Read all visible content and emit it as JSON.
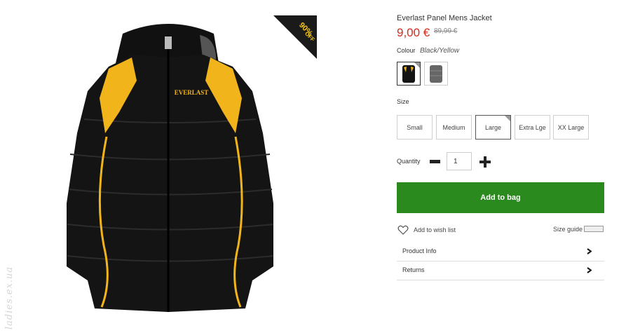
{
  "product": {
    "title": "Everlast Panel Mens Jacket",
    "price": "9,00 €",
    "old_price": "89,99 €",
    "badge_text": "UP TO 90% OFF",
    "brand_logo": "EVERLAST"
  },
  "colour": {
    "label": "Colour",
    "value": "Black/Yellow",
    "swatches": [
      "black-yellow",
      "grey"
    ]
  },
  "size": {
    "label": "Size",
    "options": [
      "Small",
      "Medium",
      "Large",
      "Extra Lge",
      "XX Large"
    ],
    "selected": "Large"
  },
  "quantity": {
    "label": "Quantity",
    "value": "1"
  },
  "actions": {
    "add_to_bag": "Add to bag",
    "wishlist": "Add to wish list",
    "size_guide": "Size guide"
  },
  "accordion": [
    "Product Info",
    "Returns"
  ],
  "watermark": "ladies.ex.ua",
  "colors": {
    "price": "#d42d1b",
    "add_to_bag": "#2b8a1e",
    "badge": "#1a1a1a",
    "badge_text": "#f5c518"
  }
}
